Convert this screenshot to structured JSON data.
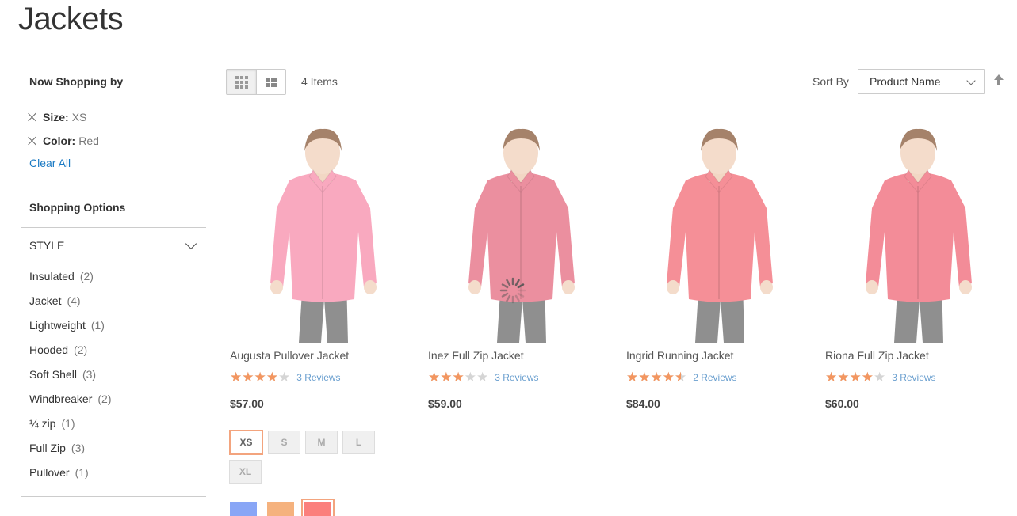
{
  "page_title": "Jackets",
  "sidebar": {
    "now_shopping_title": "Now Shopping by",
    "active_filters": [
      {
        "label": "Size:",
        "value": "XS"
      },
      {
        "label": "Color:",
        "value": "Red"
      }
    ],
    "clear_all": "Clear All",
    "shopping_options_title": "Shopping Options",
    "style_filter": {
      "title": "STYLE",
      "items": [
        {
          "name": "Insulated",
          "count": "(2)"
        },
        {
          "name": "Jacket",
          "count": "(4)"
        },
        {
          "name": "Lightweight",
          "count": "(1)"
        },
        {
          "name": "Hooded",
          "count": "(2)"
        },
        {
          "name": "Soft Shell",
          "count": "(3)"
        },
        {
          "name": "Windbreaker",
          "count": "(2)"
        },
        {
          "name": "¼ zip",
          "count": "(1)"
        },
        {
          "name": "Full Zip",
          "count": "(3)"
        },
        {
          "name": "Pullover",
          "count": "(1)"
        }
      ]
    }
  },
  "toolbar": {
    "view_modes": [
      "grid",
      "list"
    ],
    "active_mode": "grid",
    "amount": "4 Items",
    "sort_label": "Sort By",
    "sort_value": "Product Name",
    "sort_direction_icon": "arrow-up-icon"
  },
  "products": [
    {
      "name": "Augusta Pullover Jacket",
      "rating_percent": 80,
      "reviews": "3 Reviews",
      "price": "$57.00",
      "jacket_color": "#f9a9bf"
    },
    {
      "name": "Inez Full Zip Jacket",
      "rating_percent": 60,
      "reviews": "3 Reviews",
      "price": "$59.00",
      "jacket_color": "#eb8f9f"
    },
    {
      "name": "Ingrid Running Jacket",
      "rating_percent": 90,
      "reviews": "2 Reviews",
      "price": "$84.00",
      "jacket_color": "#f58f97"
    },
    {
      "name": "Riona Full Zip Jacket",
      "rating_percent": 80,
      "reviews": "3 Reviews",
      "price": "$60.00",
      "jacket_color": "#f38c98"
    }
  ],
  "swatches": {
    "sizes": [
      [
        "XS",
        "S",
        "M",
        "L"
      ],
      [
        "XL"
      ]
    ],
    "selected_size": "XS",
    "colors": [
      "#89a6f6",
      "#f5b27e",
      "#fb7f7c"
    ],
    "selected_color_index": 2
  },
  "loading_indicator": "spinner-icon"
}
